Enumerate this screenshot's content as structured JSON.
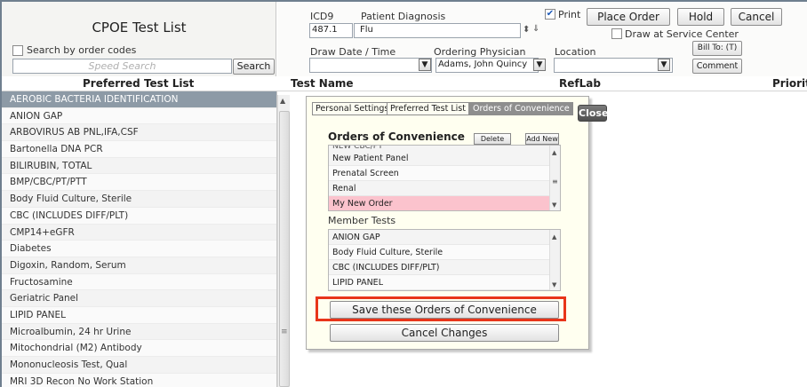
{
  "left_header": {
    "title": "CPOE Test List",
    "search_by_codes_label": "Search by order codes",
    "speed_search_placeholder": "Speed Search",
    "search_button": "Search"
  },
  "order_header": {
    "icd9_label": "ICD9",
    "icd9_value": "487.1",
    "diagnosis_label": "Patient Diagnosis",
    "diagnosis_value": "Flu",
    "print_label": "Print",
    "print_checked": true,
    "place_order": "Place Order",
    "hold": "Hold",
    "cancel": "Cancel",
    "draw_at_service_label": "Draw at Service Center",
    "draw_date_label": "Draw Date / Time",
    "physician_label": "Ordering Physician",
    "physician_value": "Adams, John Quincy",
    "location_label": "Location",
    "bill_to": "Bill To: (T)",
    "comment": "Comment"
  },
  "columns": {
    "preferred": "Preferred Test List",
    "test_name": "Test Name",
    "reflab": "RefLab",
    "priority": "Priorit"
  },
  "preferred_tests": [
    "AEROBIC BACTERIA IDENTIFICATION",
    "ANION GAP",
    "ARBOVIRUS AB PNL,IFA,CSF",
    "Bartonella DNA PCR",
    "BILIRUBIN, TOTAL",
    "BMP/CBC/PT/PTT",
    "Body Fluid Culture, Sterile",
    "CBC (INCLUDES DIFF/PLT)",
    "CMP14+eGFR",
    "Diabetes",
    "Digoxin, Random, Serum",
    "Fructosamine",
    "Geriatric Panel",
    "LIPID PANEL",
    "Microalbumin, 24 hr Urine",
    "Mitochondrial (M2) Antibody",
    "Mononucleosis Test, Qual",
    "MRI 3D Recon No Work Station"
  ],
  "popup": {
    "tabs": [
      "Personal Settings",
      "Preferred Test List",
      "Orders of Convenience"
    ],
    "close": "Close",
    "title": "Orders of Convenience",
    "delete": "Delete",
    "add_new": "Add New",
    "partial_item": "NEW CBC/PT",
    "orders": [
      "New Patient Panel",
      "Prenatal Screen",
      "Renal",
      "My New Order"
    ],
    "member_tests_label": "Member Tests",
    "member_tests": [
      "ANION GAP",
      "Body Fluid Culture, Sterile",
      "CBC (INCLUDES DIFF/PLT)",
      "LIPID PANEL"
    ],
    "save_button": "Save these Orders of Convenience",
    "cancel_button": "Cancel Changes"
  },
  "colors": {
    "selected_row": "#8d9aa6",
    "selected_order": "#fbc3cd",
    "highlight": "#e8351a",
    "popup_bg": "#fffff0"
  }
}
